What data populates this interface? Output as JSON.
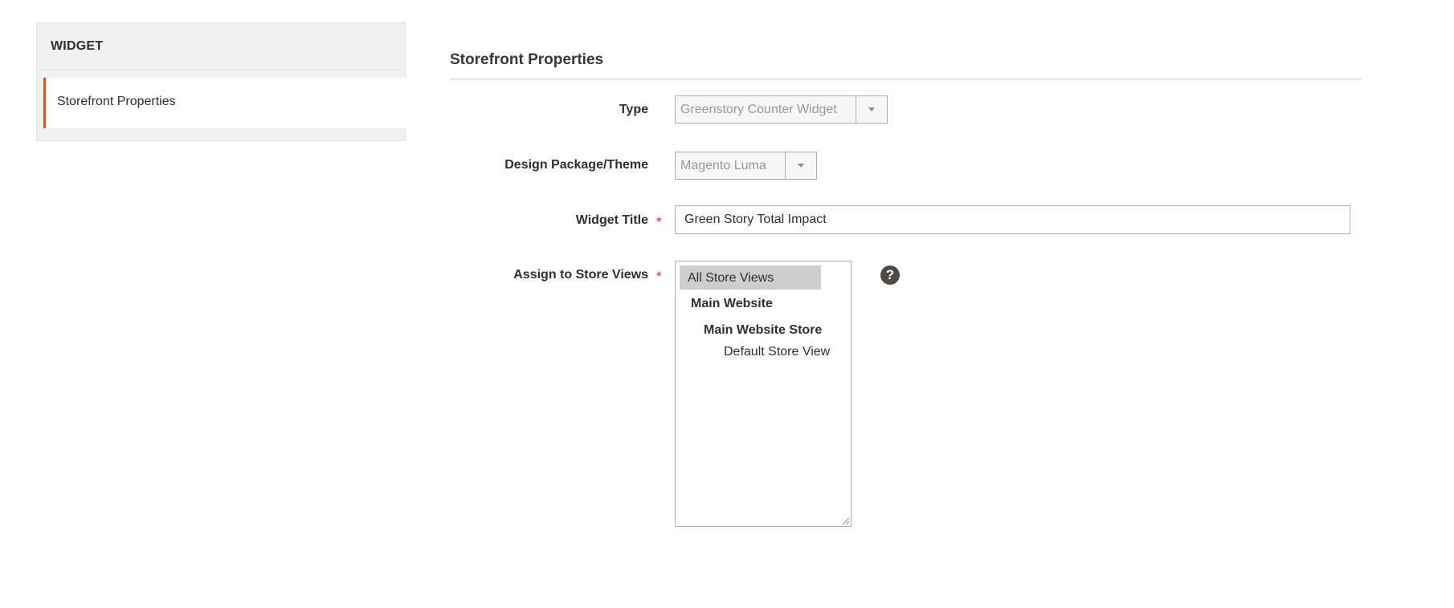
{
  "sidebar": {
    "title": "WIDGET",
    "items": [
      {
        "label": "Storefront Properties",
        "active": true
      }
    ]
  },
  "section": {
    "title": "Storefront Properties"
  },
  "form": {
    "type": {
      "label": "Type",
      "value": "Greenstory Counter Widget"
    },
    "theme": {
      "label": "Design Package/Theme",
      "value": "Magento Luma"
    },
    "widget_title": {
      "label": "Widget Title",
      "required_mark": "*",
      "value": "Green Story Total Impact"
    },
    "store_views": {
      "label": "Assign to Store Views",
      "required_mark": "*",
      "options": [
        {
          "label": "All Store Views",
          "selected": true
        },
        {
          "label": "Main Website"
        },
        {
          "label": "Main Website Store"
        },
        {
          "label": "Default Store View"
        }
      ],
      "help_icon": "question-circle-icon",
      "help_glyph": "?"
    }
  },
  "colors": {
    "accent": "#eb5202",
    "required": "#e22626",
    "help_bg": "#514943",
    "selected_option_bg": "#cecece"
  }
}
